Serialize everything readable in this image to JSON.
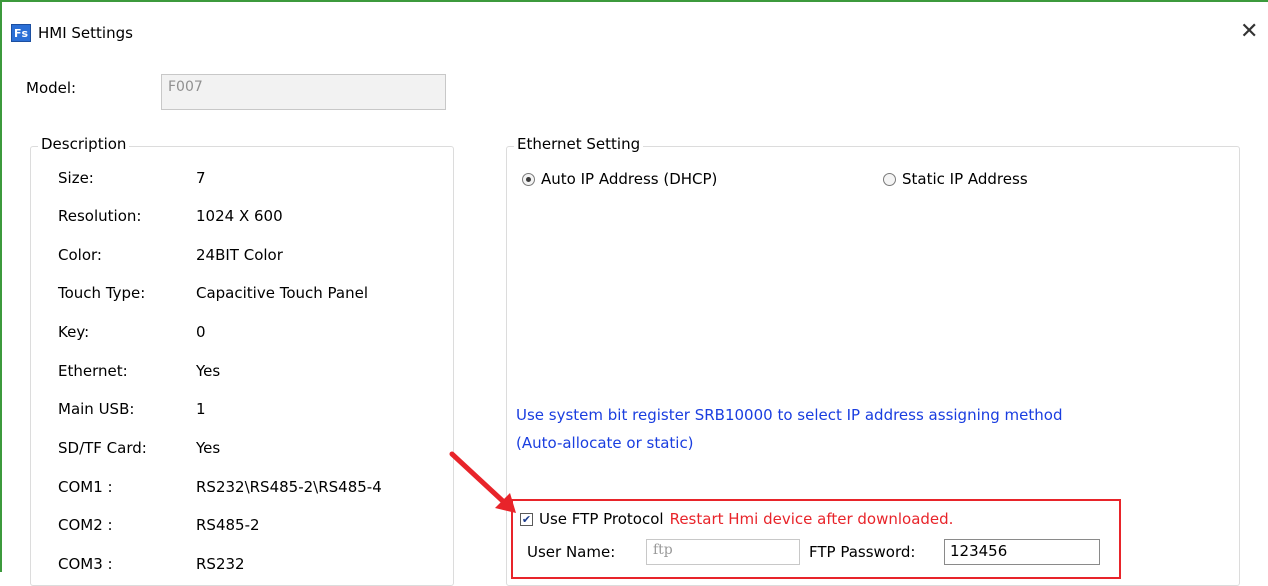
{
  "window": {
    "app_icon_text": "Fs",
    "title": "HMI Settings",
    "close_glyph": "✕"
  },
  "model": {
    "label": "Model:",
    "value": "F007"
  },
  "description": {
    "legend": "Description",
    "rows": [
      {
        "label": "Size:",
        "value": "7"
      },
      {
        "label": "Resolution:",
        "value": "1024 X 600"
      },
      {
        "label": "Color:",
        "value": "24BIT Color"
      },
      {
        "label": "Touch Type:",
        "value": "Capacitive Touch Panel"
      },
      {
        "label": "Key:",
        "value": "0"
      },
      {
        "label": "Ethernet:",
        "value": "Yes"
      },
      {
        "label": "Main USB:",
        "value": "1"
      },
      {
        "label": "SD/TF Card:",
        "value": "Yes"
      },
      {
        "label": "COM1 :",
        "value": "RS232\\RS485-2\\RS485-4"
      },
      {
        "label": "COM2 :",
        "value": "RS485-2"
      },
      {
        "label": "COM3 :",
        "value": "RS232"
      }
    ]
  },
  "ethernet": {
    "legend": "Ethernet Setting",
    "auto_ip_label": "Auto IP Address (DHCP)",
    "auto_ip_selected": true,
    "static_ip_label": "Static IP Address",
    "static_ip_selected": false,
    "info_line1": "Use system bit register SRB10000 to select IP address assigning method",
    "info_line2": "(Auto-allocate or static)"
  },
  "ftp": {
    "checkbox_label": "Use FTP Protocol",
    "checked": true,
    "restart_note": "Restart Hmi device after downloaded.",
    "user_name_label": "User Name:",
    "user_name_value": "ftp",
    "password_label": "FTP Password:",
    "password_value": "123456"
  },
  "colors": {
    "highlight": "#e8242a",
    "info_text": "#1a3ee0",
    "window_accent": "#3c9a3c"
  }
}
